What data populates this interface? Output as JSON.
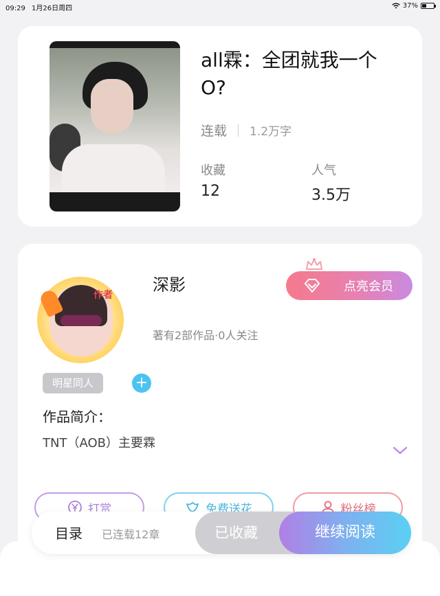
{
  "status_bar": {
    "time": "09:29",
    "date": "1月26日周四",
    "battery": "37%",
    "battery_level": 0.37
  },
  "book": {
    "title": "all霖：全团就我一个O?",
    "status": "连载",
    "word_count": "1.2万字",
    "stats": [
      {
        "label": "收藏",
        "value": "12"
      },
      {
        "label": "人气",
        "value": "3.5万"
      }
    ]
  },
  "author": {
    "name": "深影",
    "avatar_badge": "作者",
    "meta": "著有2部作品·0人关注",
    "vip_button": "点亮会员",
    "tag": "明星同人",
    "add_tag_symbol": "+"
  },
  "intro": {
    "label": "作品简介：",
    "text": "TNT（AOB）主要霖"
  },
  "actions": [
    {
      "label": "打赏",
      "icon": "yuan-coin-icon",
      "color": "#a97fd9"
    },
    {
      "label": "免费送花",
      "icon": "flower-icon",
      "color": "#4bb7e0"
    },
    {
      "label": "粉丝榜",
      "icon": "fan-user-icon",
      "color": "#e36d7e"
    }
  ],
  "bottom_bar": {
    "toc": "目录",
    "chapters": "已连载12章",
    "collected": "已收藏",
    "continue": "继续阅读"
  }
}
